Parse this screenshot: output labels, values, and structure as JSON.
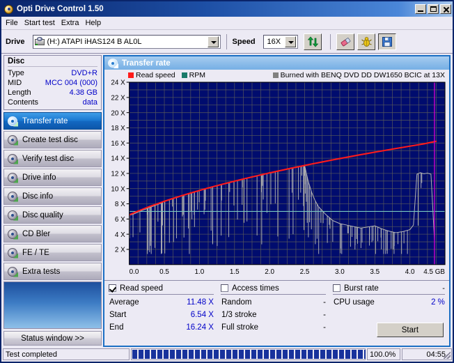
{
  "window": {
    "title": "Opti Drive Control 1.50",
    "title_icon": "disc-icon",
    "minimize_label": "_",
    "maximize_label": "□",
    "close_label": "×"
  },
  "menubar": {
    "items": [
      "File",
      "Start test",
      "Extra",
      "Help"
    ]
  },
  "toolbar": {
    "drive_label": "Drive",
    "drive_value": "(H:)  ATAPI iHAS124   B AL0L",
    "speed_label": "Speed",
    "speed_value": "16X",
    "buttons": [
      {
        "name": "refresh-icon",
        "title": "refresh"
      },
      {
        "name": "eraser-icon",
        "title": "erase"
      },
      {
        "name": "bug-icon",
        "title": "tools"
      },
      {
        "name": "save-icon",
        "title": "save"
      }
    ]
  },
  "disc": {
    "heading": "Disc",
    "rows": [
      {
        "key": "Type",
        "value": "DVD+R"
      },
      {
        "key": "MID",
        "value": "MCC 004 (000)"
      },
      {
        "key": "Length",
        "value": "4.38 GB"
      },
      {
        "key": "Contents",
        "value": "data"
      }
    ]
  },
  "sidebar": {
    "items": [
      {
        "label": "Transfer rate",
        "active": true
      },
      {
        "label": "Create test disc",
        "active": false
      },
      {
        "label": "Verify test disc",
        "active": false
      },
      {
        "label": "Drive info",
        "active": false
      },
      {
        "label": "Disc info",
        "active": false
      },
      {
        "label": "Disc quality",
        "active": false
      },
      {
        "label": "CD Bler",
        "active": false
      },
      {
        "label": "FE / TE",
        "active": false
      },
      {
        "label": "Extra tests",
        "active": false
      }
    ],
    "status_window_label": "Status window >>"
  },
  "panel": {
    "title": "Transfer rate",
    "icon": "disc-icon"
  },
  "results": {
    "read_speed": {
      "label": "Read speed",
      "checked": true,
      "rows": [
        {
          "key": "Average",
          "value": "11.48 X"
        },
        {
          "key": "Start",
          "value": "6.54 X"
        },
        {
          "key": "End",
          "value": "16.24 X"
        }
      ]
    },
    "access_times": {
      "label": "Access times",
      "checked": false,
      "header_value": "",
      "rows": [
        {
          "key": "Random",
          "value": "-"
        },
        {
          "key": "1/3 stroke",
          "value": "-"
        },
        {
          "key": "Full stroke",
          "value": "-"
        }
      ]
    },
    "burst_rate": {
      "label": "Burst rate",
      "checked": false,
      "header_value": "-",
      "rows": [
        {
          "key": "CPU usage",
          "value": "2 %"
        }
      ]
    },
    "start_button": "Start"
  },
  "statusbar": {
    "message": "Test completed",
    "progress_pct": "100.0%",
    "progress_value": 100,
    "elapsed": "04:55"
  },
  "chart_data": {
    "type": "line",
    "title": "Transfer rate",
    "xlabel": "GB",
    "ylabel": "X",
    "xlim": [
      0.0,
      4.5
    ],
    "ylim": [
      0,
      24
    ],
    "xticks": [
      "0.0",
      "0.5",
      "1.0",
      "1.5",
      "2.0",
      "2.5",
      "3.0",
      "3.5",
      "4.0",
      "4.5 GB"
    ],
    "yticks": [
      "2 X",
      "4 X",
      "6 X",
      "8 X",
      "10 X",
      "12 X",
      "14 X",
      "16 X",
      "18 X",
      "20 X",
      "22 X",
      "24 X"
    ],
    "grid": true,
    "plot_bg": "#000c6e",
    "grid_color": "#5a5a5a",
    "legend_position": "top",
    "legend": [
      {
        "name": "Read speed",
        "color": "#ff1a1a"
      },
      {
        "name": "RPM",
        "color": "#1a7a6a"
      }
    ],
    "annotation": "Burned with BENQ DVD DD DW1650 BCIC at 13X",
    "annotation_color": "#808080",
    "rpm_line_y": 7.0,
    "end_marker_x": 4.35,
    "end_marker_color": "#cc00cc",
    "series": [
      {
        "name": "Read speed",
        "color": "#ff1a1a",
        "x": [
          0.0,
          0.1,
          0.2,
          0.3,
          0.4,
          0.5,
          0.6,
          0.7,
          0.8,
          0.9,
          1.0,
          1.1,
          1.2,
          1.3,
          1.4,
          1.5,
          1.6,
          1.7,
          1.8,
          1.9,
          2.0,
          2.1,
          2.2,
          2.3,
          2.4,
          2.5,
          2.6,
          2.7,
          2.8,
          2.9,
          3.0,
          3.1,
          3.2,
          3.3,
          3.4,
          3.5,
          3.6,
          3.7,
          3.8,
          3.9,
          4.0,
          4.1,
          4.2,
          4.3,
          4.38
        ],
        "y": [
          6.54,
          6.95,
          7.32,
          7.68,
          8.0,
          8.33,
          8.64,
          8.93,
          9.22,
          9.49,
          9.76,
          10.02,
          10.27,
          10.51,
          10.75,
          10.98,
          11.21,
          11.43,
          11.65,
          11.86,
          12.07,
          12.27,
          12.47,
          12.67,
          12.86,
          13.05,
          13.24,
          13.42,
          13.6,
          13.78,
          13.96,
          14.13,
          14.3,
          14.47,
          14.63,
          14.8,
          14.96,
          15.12,
          15.28,
          15.43,
          15.59,
          15.74,
          15.89,
          16.09,
          16.24
        ]
      },
      {
        "name": "RPM",
        "color": "#1a7a6a",
        "note": "constant angular velocity reference line at 7 X"
      },
      {
        "name": "Measured read trace",
        "color": "#b4b4b4",
        "note": "noisy sampled trace with dropout spikes; follows read-speed curve until ~2.5 GB then falls to 4-6 X, jumping to ~12 X at ~4.1 GB",
        "x": [
          0.0,
          0.05,
          0.1,
          0.15,
          0.2,
          0.25,
          0.3,
          0.35,
          0.4,
          0.45,
          0.5,
          0.6,
          0.7,
          0.8,
          0.9,
          1.0,
          1.1,
          1.2,
          1.3,
          1.4,
          1.5,
          1.6,
          1.7,
          1.8,
          1.9,
          2.0,
          2.1,
          2.2,
          2.3,
          2.4,
          2.5,
          2.55,
          2.6,
          2.65,
          2.7,
          2.75,
          2.8,
          2.9,
          3.0,
          3.1,
          3.2,
          3.3,
          3.4,
          3.5,
          3.6,
          3.7,
          3.8,
          3.9,
          4.0,
          4.05,
          4.1,
          4.15,
          4.2,
          4.25,
          4.3,
          4.35
        ],
        "y": [
          6.5,
          6.6,
          6.8,
          7.0,
          7.2,
          7.35,
          7.55,
          7.7,
          7.9,
          8.05,
          8.3,
          8.6,
          8.9,
          9.2,
          9.45,
          9.75,
          10.0,
          10.25,
          10.5,
          10.7,
          10.95,
          11.2,
          11.4,
          11.6,
          11.85,
          12.05,
          12.25,
          12.45,
          12.65,
          12.85,
          13.0,
          11.0,
          9.5,
          8.4,
          7.6,
          7.1,
          6.6,
          5.8,
          5.4,
          5.2,
          5.0,
          4.8,
          4.95,
          5.1,
          4.7,
          4.4,
          4.2,
          4.35,
          4.6,
          5.2,
          11.9,
          12.1,
          11.95,
          12.05,
          11.9,
          3.2
        ]
      }
    ]
  }
}
